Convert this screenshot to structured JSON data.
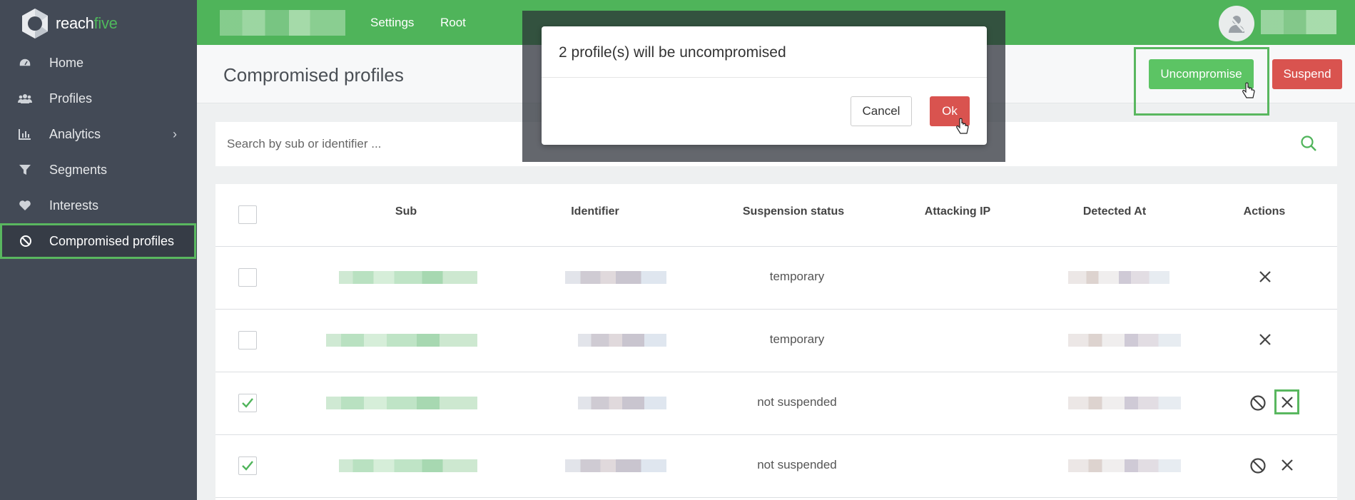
{
  "brand": {
    "name_part1": "reach",
    "name_part2": "five",
    "accent": "#4fb45a"
  },
  "sidebar": {
    "items": [
      {
        "label": "Home",
        "icon": "dashboard-icon"
      },
      {
        "label": "Profiles",
        "icon": "users-icon"
      },
      {
        "label": "Analytics",
        "icon": "bar-chart-icon",
        "has_submenu": true
      },
      {
        "label": "Segments",
        "icon": "filter-icon"
      },
      {
        "label": "Interests",
        "icon": "heart-icon"
      },
      {
        "label": "Compromised profiles",
        "icon": "ban-icon",
        "active": true
      }
    ]
  },
  "topbar": {
    "links": [
      "Settings",
      "Root"
    ]
  },
  "header": {
    "title": "Compromised profiles",
    "uncompromise_label": "Uncompromise",
    "suspend_label": "Suspend"
  },
  "search": {
    "placeholder": "Search by sub or identifier ..."
  },
  "table": {
    "columns": [
      "Sub",
      "Identifier",
      "Suspension status",
      "Attacking IP",
      "Detected At",
      "Actions"
    ],
    "rows": [
      {
        "checked": false,
        "status": "temporary",
        "actions": [
          "remove"
        ]
      },
      {
        "checked": false,
        "status": "temporary",
        "actions": [
          "remove"
        ]
      },
      {
        "checked": true,
        "status": "not suspended",
        "actions": [
          "suspend",
          "remove"
        ]
      },
      {
        "checked": true,
        "status": "not suspended",
        "actions": [
          "suspend",
          "remove"
        ]
      }
    ]
  },
  "modal": {
    "message": "2 profile(s) will be uncompromised",
    "cancel_label": "Cancel",
    "ok_label": "Ok"
  }
}
